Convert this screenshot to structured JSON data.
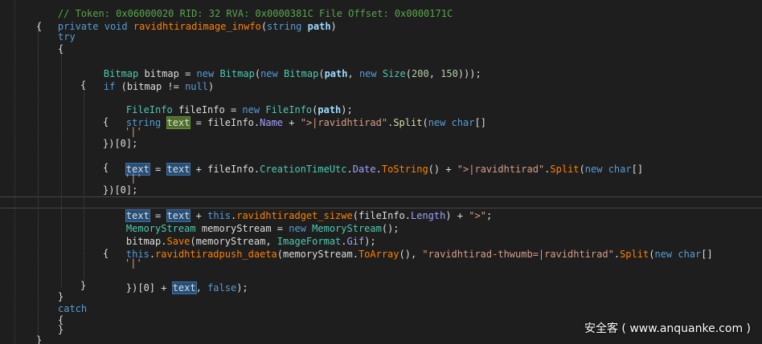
{
  "lines": {
    "l0": "// Token: 0x06000020 RID: 32 RVA: 0x0000381C File Offset: 0x0000171C",
    "l1_private": "private",
    "l1_void": "void",
    "l1_name": "ravidhtiradimage_inwfo",
    "l1_string": "string",
    "l1_param": "path",
    "open": "{",
    "close": "}",
    "try": "try",
    "catch": "catch",
    "bitmap_type": "Bitmap",
    "bitmap_var": "bitmap",
    "new": "new",
    "path": "path",
    "size_type": "Size",
    "num200": "200",
    "num150": "150",
    "if": "if",
    "bitmap_cond": "(bitmap != ",
    "null": "null",
    "fileinfo_type": "FileInfo",
    "fileinfo_var": "fileInfo",
    "string_kw": "string",
    "text": "text",
    "name_prop": "Name",
    "str_sep": "\">|ravidhtirad\"",
    "split": "Split",
    "char_kw": "char",
    "sep_char": "'|'",
    "index0": "})[0];",
    "index0_plus": "})[0] + ",
    "creation": "CreationTimeUtc",
    "date": "Date",
    "tostring": "ToString",
    "this_kw": "this",
    "get_size": "ravidhtiradget_sizwe",
    "length": "Length",
    "str_gt": "\">\"",
    "memstream_type": "MemoryStream",
    "memstream_var": "memoryStream",
    "save": "Save",
    "imageformat": "ImageFormat",
    "gif": "Gif",
    "push": "ravidhtiradpush_daeta",
    "toarray": "ToArray",
    "str_thumb": "\"ravidhtirad-thwumb=|ravidhtirad\"",
    "false_kw": "false"
  },
  "watermark": "安全客 ( www.anquanke.com )"
}
